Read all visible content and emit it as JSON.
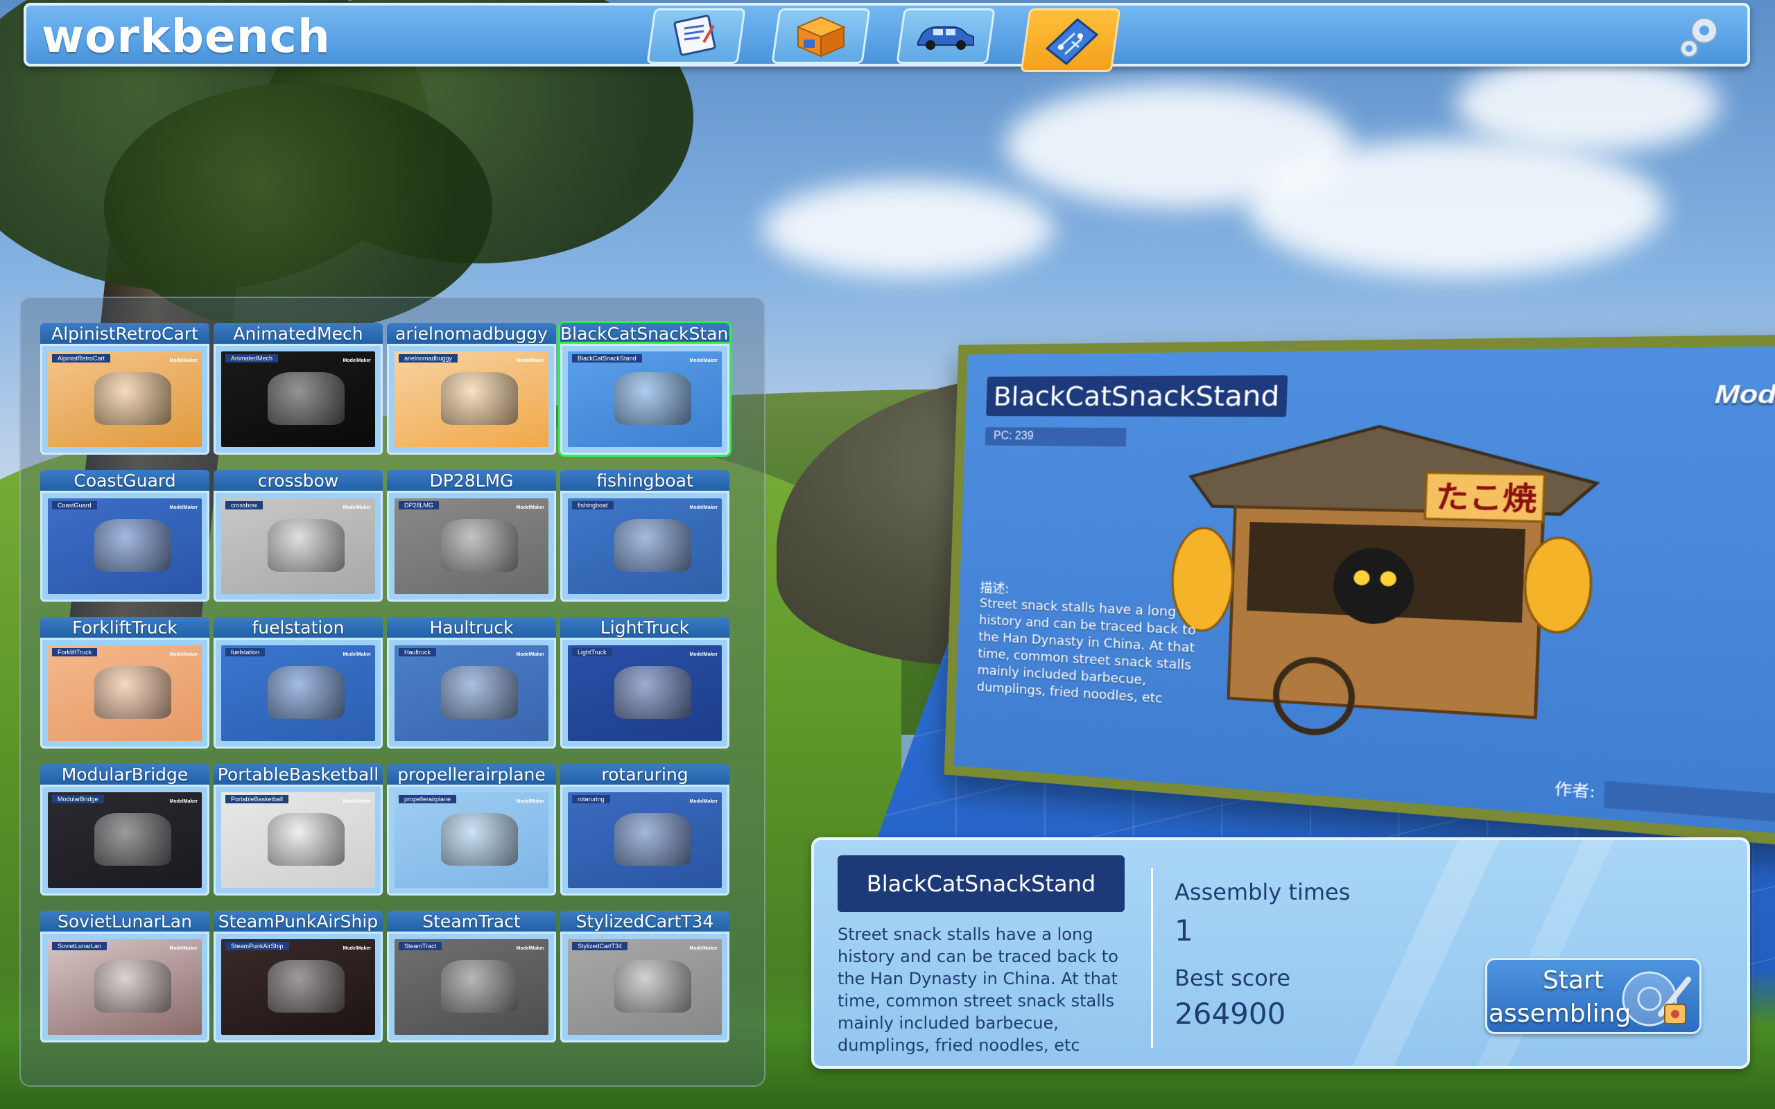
{
  "app": {
    "title": "workbench"
  },
  "top_tabs": [
    {
      "icon": "blueprint-icon",
      "active": false
    },
    {
      "icon": "package-box-icon",
      "active": false
    },
    {
      "icon": "car-icon",
      "active": false
    },
    {
      "icon": "circuit-board-icon",
      "active": true
    }
  ],
  "models": [
    {
      "name": "AlpinistRetroCart",
      "colors": [
        "#f5c48a",
        "#e09a3e"
      ],
      "selected": false
    },
    {
      "name": "AnimatedMech",
      "colors": [
        "#1a1a1a",
        "#0a0a0a"
      ],
      "selected": false
    },
    {
      "name": "arielnomadbuggy",
      "colors": [
        "#f7d2a0",
        "#f0a84a"
      ],
      "selected": false
    },
    {
      "name": "BlackCatSnackStand",
      "colors": [
        "#5aa0ea",
        "#3c7fd0"
      ],
      "selected": true
    },
    {
      "name": "CoastGuard",
      "colors": [
        "#3c6fc8",
        "#2a56a8"
      ],
      "selected": false
    },
    {
      "name": "crossbow",
      "colors": [
        "#c8c8c8",
        "#a8a8a8"
      ],
      "selected": false
    },
    {
      "name": "DP28LMG",
      "colors": [
        "#8a8a8a",
        "#6a6a6a"
      ],
      "selected": false
    },
    {
      "name": "fishingboat",
      "colors": [
        "#3f77c9",
        "#2e5faa"
      ],
      "selected": false
    },
    {
      "name": "ForkliftTruck",
      "colors": [
        "#f3b88b",
        "#e79a66"
      ],
      "selected": false
    },
    {
      "name": "fuelstation",
      "colors": [
        "#3a76cf",
        "#2d5fb0"
      ],
      "selected": false
    },
    {
      "name": "Haultruck",
      "colors": [
        "#4b7fc9",
        "#3a66ad"
      ],
      "selected": false
    },
    {
      "name": "LightTruck",
      "colors": [
        "#2a4fa8",
        "#1d3e8a"
      ],
      "selected": false
    },
    {
      "name": "ModularBridge",
      "colors": [
        "#2a2a30",
        "#1a1a20"
      ],
      "selected": false
    },
    {
      "name": "PortableBasketball",
      "colors": [
        "#e8e8e8",
        "#cfcfcf"
      ],
      "selected": false
    },
    {
      "name": "propellerairplane",
      "colors": [
        "#9ecdf2",
        "#7fb6e6"
      ],
      "selected": false
    },
    {
      "name": "rotaruring",
      "colors": [
        "#3b6bc0",
        "#2a55a3"
      ],
      "selected": false
    },
    {
      "name": "SovietLunarLan",
      "colors": [
        "#d8c6c6",
        "#8a6a6a"
      ],
      "selected": false
    },
    {
      "name": "SteamPunkAirShip",
      "colors": [
        "#3a2a2a",
        "#1e1414"
      ],
      "selected": false
    },
    {
      "name": "SteamTract",
      "colors": [
        "#707070",
        "#4e4e4e"
      ],
      "selected": false
    },
    {
      "name": "StylizedCartT34",
      "colors": [
        "#a8a8a8",
        "#888888"
      ],
      "selected": false
    }
  ],
  "card_brand": "ModelMaker",
  "preview": {
    "title": "BlackCatSnackStand",
    "pc": "PC:    239",
    "brand": "ModelMaker",
    "desc_label": "描述:",
    "description": "Street snack stalls have a long history and can be traced back to the Han Dynasty in China. At that time, common street snack stalls mainly included barbecue, dumplings, fried noodles, etc",
    "author_label": "作者:",
    "sign_text": "たこ焼"
  },
  "info": {
    "name": "BlackCatSnackStand",
    "description": "Street snack stalls have a long history and can be traced back to the Han Dynasty in China. At that time, common street snack stalls mainly included barbecue, dumplings, fried noodles, etc",
    "assembly_label": "Assembly times",
    "assembly_value": "1",
    "best_label": "Best score",
    "best_value": "264900",
    "start_line1": "Start",
    "start_line2": "assembling"
  },
  "colors": {
    "accent": "#1d3a78",
    "selected_outline": "#2ef04a",
    "active_tab": "#f4a21c"
  }
}
